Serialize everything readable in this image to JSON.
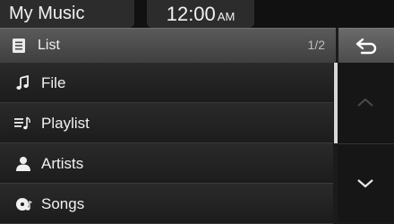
{
  "status": {
    "app_title": "My Music",
    "time": "12:00",
    "ampm": "AM"
  },
  "header": {
    "icon": "list-icon",
    "title": "List",
    "page_indicator": "1/2"
  },
  "back_button": {
    "icon": "back-arrow-icon"
  },
  "list": {
    "items": [
      {
        "label": "File",
        "icon": "music-note-icon"
      },
      {
        "label": "Playlist",
        "icon": "playlist-icon"
      },
      {
        "label": "Artists",
        "icon": "person-icon"
      },
      {
        "label": "Songs",
        "icon": "song-disc-icon"
      }
    ]
  },
  "nav": {
    "up_icon": "chevron-up-icon",
    "down_icon": "chevron-down-icon",
    "up_enabled": false,
    "down_enabled": true
  },
  "colors": {
    "background": "#1b1b1b",
    "header": "#4a4a4a",
    "text": "#ffffff",
    "scrollbar": "#d8d8d8"
  }
}
